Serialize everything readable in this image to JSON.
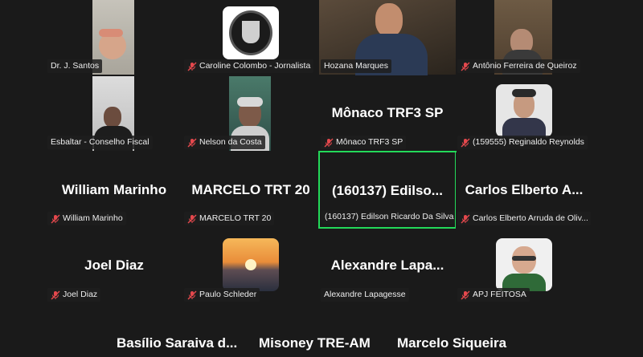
{
  "tiles": [
    {
      "id": "t1",
      "name": "Dr. J. Santos",
      "muted": false
    },
    {
      "id": "t2",
      "name": "Caroline Colombo - Jornalista",
      "muted": true
    },
    {
      "id": "t3",
      "name": "Hozana Marques",
      "muted": false
    },
    {
      "id": "t4",
      "name": "Antônio Ferreira de Queiroz",
      "muted": true
    },
    {
      "id": "t5",
      "name": "Esbaltar - Conselho Fiscal",
      "muted": false
    },
    {
      "id": "t6",
      "name": "Nelson da Costa",
      "muted": true
    },
    {
      "id": "t7",
      "name": "Mônaco TRF3 SP",
      "big": "Mônaco TRF3 SP",
      "muted": true
    },
    {
      "id": "t8",
      "name": "(159555) Reginaldo Reynolds",
      "muted": true
    },
    {
      "id": "t9",
      "name": "William Marinho",
      "big": "William Marinho",
      "muted": true
    },
    {
      "id": "t10",
      "name": "MARCELO TRT 20",
      "big": "MARCELO TRT 20",
      "muted": true
    },
    {
      "id": "t11",
      "name": "(160137) Edilson Ricardo Da Silva",
      "big": "(160137)  Edilso...",
      "muted": false,
      "active": true
    },
    {
      "id": "t12",
      "name": "Carlos Elberto Arruda de Oliv...",
      "big": "Carlos Elberto A...",
      "muted": true
    },
    {
      "id": "t13",
      "name": "Joel Diaz",
      "big": "Joel Diaz",
      "muted": true
    },
    {
      "id": "t14",
      "name": "Paulo Schleder",
      "muted": true
    },
    {
      "id": "t15",
      "name": "Alexandre Lapagesse",
      "big": "Alexandre  Lapa...",
      "muted": false
    },
    {
      "id": "t16",
      "name": "APJ FEITOSA",
      "muted": true
    }
  ],
  "bottom_row": [
    "Basílio Saraiva d...",
    "Misoney TRE-AM",
    "Marcelo Siqueira"
  ],
  "colors": {
    "active_border": "#23d959",
    "mute_red": "#e5484d",
    "background": "#1a1a1a"
  }
}
